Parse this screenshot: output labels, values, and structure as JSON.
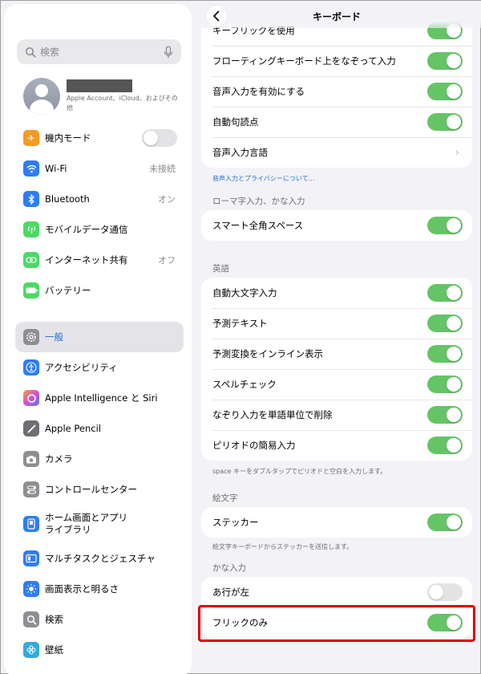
{
  "sidebar": {
    "search_placeholder": "検索",
    "profile_sub": "Apple Account、iCloud、およびその他",
    "items": [
      {
        "label": "機内モード",
        "value": "",
        "icon": "airplane-icon",
        "color": "#f59a23"
      },
      {
        "label": "Wi-Fi",
        "value": "未接続",
        "icon": "wifi-icon",
        "color": "#2f7cf6"
      },
      {
        "label": "Bluetooth",
        "value": "オン",
        "icon": "bluetooth-icon",
        "color": "#2f7cf6"
      },
      {
        "label": "モバイルデータ通信",
        "value": "",
        "icon": "antenna-icon",
        "color": "#4cd964"
      },
      {
        "label": "インターネット共有",
        "value": "オフ",
        "icon": "link-icon",
        "color": "#4cd964"
      },
      {
        "label": "バッテリー",
        "value": "",
        "icon": "battery-icon",
        "color": "#4cd964"
      },
      {
        "label": "一般",
        "value": "",
        "icon": "gear-icon",
        "color": "#8e8e93"
      },
      {
        "label": "アクセシビリティ",
        "value": "",
        "icon": "accessibility-icon",
        "color": "#2f7cf6"
      },
      {
        "label": "Apple Intelligence と Siri",
        "value": "",
        "icon": "siri-icon",
        "color": "#c86dd7"
      },
      {
        "label": "Apple Pencil",
        "value": "",
        "icon": "pencil-icon",
        "color": "#6e6e73"
      },
      {
        "label": "カメラ",
        "value": "",
        "icon": "camera-icon",
        "color": "#8e8e93"
      },
      {
        "label": "コントロールセンター",
        "value": "",
        "icon": "control-center-icon",
        "color": "#8e8e93"
      },
      {
        "label": "ホーム画面とアプリ",
        "label2": "ライブラリ",
        "value": "",
        "icon": "home-screen-icon",
        "color": "#2f7cf6"
      },
      {
        "label": "マルチタスクとジェスチャ",
        "value": "",
        "icon": "multitask-icon",
        "color": "#2f7cf6"
      },
      {
        "label": "画面表示と明るさ",
        "value": "",
        "icon": "brightness-icon",
        "color": "#2f7cf6"
      },
      {
        "label": "検索",
        "value": "",
        "icon": "search-icon",
        "color": "#8e8e93"
      },
      {
        "label": "壁紙",
        "value": "",
        "icon": "wallpaper-icon",
        "color": "#34aadc"
      }
    ]
  },
  "main": {
    "title": "キーボード",
    "group1": [
      {
        "label": "キーフリックを使用",
        "toggle": true
      },
      {
        "label": "フローティングキーボード上をなぞって入力",
        "toggle": true
      },
      {
        "label": "音声入力を有効にする",
        "toggle": true
      },
      {
        "label": "自動句読点",
        "toggle": true
      },
      {
        "label": "音声入力言語",
        "toggle": null
      }
    ],
    "group1_footer": "音声入力とプライバシーについて…",
    "romaji_header": "ローマ字入力、かな入力",
    "romaji_rows": [
      {
        "label": "スマート全角スペース",
        "toggle": true
      }
    ],
    "english_header": "英語",
    "english_rows": [
      {
        "label": "自動大文字入力",
        "toggle": true
      },
      {
        "label": "予測テキスト",
        "toggle": true
      },
      {
        "label": "予測変換をインライン表示",
        "toggle": true
      },
      {
        "label": "スペルチェック",
        "toggle": true
      },
      {
        "label": "なぞり入力を単語単位で削除",
        "toggle": true
      },
      {
        "label": "ピリオドの簡易入力",
        "toggle": true
      }
    ],
    "english_footer": "space キーをダブルタップでピリオドと空白を入力します。",
    "emoji_header": "絵文字",
    "emoji_rows": [
      {
        "label": "ステッカー",
        "toggle": true
      }
    ],
    "emoji_footer": "絵文字キーボードからステッカーを送信します。",
    "kana_header": "かな入力",
    "kana_rows": [
      {
        "label": "あ行が左",
        "toggle": false
      },
      {
        "label": "フリックのみ",
        "toggle": true
      }
    ]
  },
  "colors": {
    "toggle_on": "#65c466",
    "accent": "#1f6fdc",
    "highlight": "#e00000"
  }
}
